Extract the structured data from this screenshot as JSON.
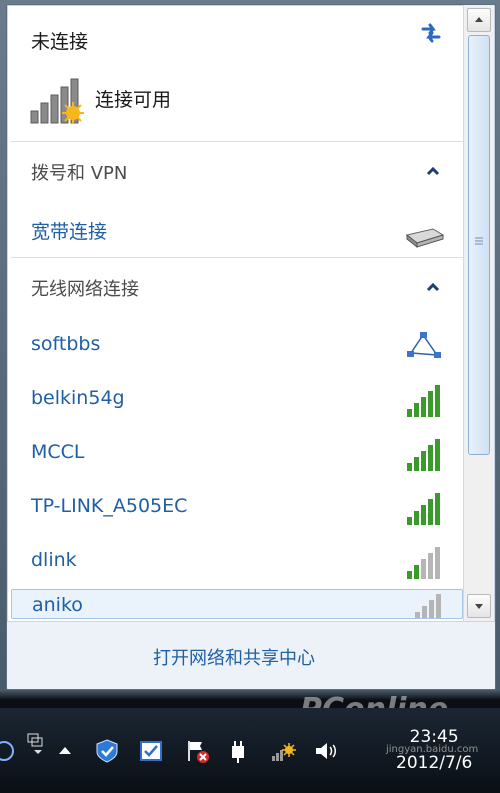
{
  "header": {
    "status": "未连接",
    "available": "连接可用"
  },
  "sections": {
    "dialup": {
      "title": "拨号和 VPN"
    },
    "wireless": {
      "title": "无线网络连接"
    }
  },
  "dialup_items": [
    {
      "name": "宽带连接",
      "icon": "modem-icon"
    }
  ],
  "wireless_items": [
    {
      "name": "softbbs",
      "icon": "adhoc-network-icon"
    },
    {
      "name": "belkin54g",
      "icon": "wifi-signal-icon",
      "bars": 5
    },
    {
      "name": "MCCL",
      "icon": "wifi-signal-icon",
      "bars": 5
    },
    {
      "name": "TP-LINK_A505EC",
      "icon": "wifi-signal-icon",
      "bars": 5
    },
    {
      "name": "dlink",
      "icon": "wifi-signal-icon",
      "bars": 2
    },
    {
      "name": "aniko",
      "icon": "wifi-signal-icon",
      "bars": 1
    }
  ],
  "footer": {
    "link": "打开网络和共享中心"
  },
  "taskbar": {
    "time": "23:45",
    "date": "2012/7/6"
  },
  "watermark": {
    "brand": "PConline",
    "sub": "jingyan.baidu.com"
  },
  "colors": {
    "link": "#1f5fa6",
    "signal_active": "#3a9a2c",
    "signal_inactive": "#b5b5b5"
  }
}
